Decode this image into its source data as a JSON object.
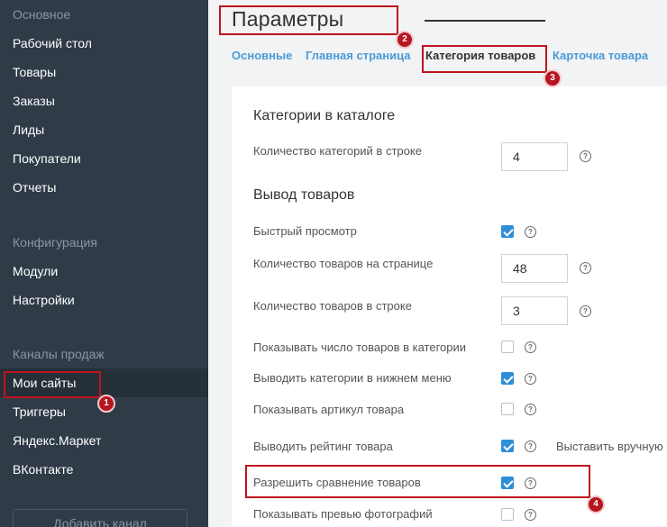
{
  "sidebar": {
    "section_main": "Основное",
    "main_items": [
      "Рабочий стол",
      "Товары",
      "Заказы",
      "Лиды",
      "Покупатели",
      "Отчеты"
    ],
    "section_config": "Конфигурация",
    "config_items": [
      "Модули",
      "Настройки"
    ],
    "section_channels": "Каналы продаж",
    "channel_items": [
      "Мои сайты",
      "Триггеры",
      "Яндекс.Маркет",
      "ВКонтакте"
    ],
    "add_channel": "Добавить канал"
  },
  "page": {
    "title": "Параметры",
    "tabs": [
      "Основные",
      "Главная страница",
      "Категория товаров",
      "Карточка товара"
    ],
    "active_tab": "Категория товаров"
  },
  "content": {
    "section_catalog": "Категории в каталоге",
    "categories_per_row_label": "Количество категорий в строке",
    "categories_per_row_value": "4",
    "section_output": "Вывод товаров",
    "quick_view_label": "Быстрый просмотр",
    "quick_view_checked": true,
    "items_per_page_label": "Количество товаров на странице",
    "items_per_page_value": "48",
    "items_per_row_label": "Количество товаров в строке",
    "items_per_row_value": "3",
    "show_count_label": "Показывать число товаров в категории",
    "show_count_checked": false,
    "bottom_menu_label": "Выводить категории в нижнем меню",
    "bottom_menu_checked": true,
    "show_sku_label": "Показывать артикул товара",
    "show_sku_checked": false,
    "rating_label": "Выводить рейтинг товара",
    "rating_checked": true,
    "rating_extra": "Выставить вручную",
    "compare_label": "Разрешить сравнение товаров",
    "compare_checked": true,
    "photo_preview_label": "Показывать превью фотографий",
    "photo_preview_checked": false,
    "help_glyph": "?"
  },
  "annotations": [
    "1",
    "2",
    "3",
    "4"
  ],
  "colors": {
    "sidebar_bg": "#2f3c48",
    "accent": "#2d8fd5",
    "tab_link": "#4a9bd6",
    "annotation": "#c0141e"
  }
}
